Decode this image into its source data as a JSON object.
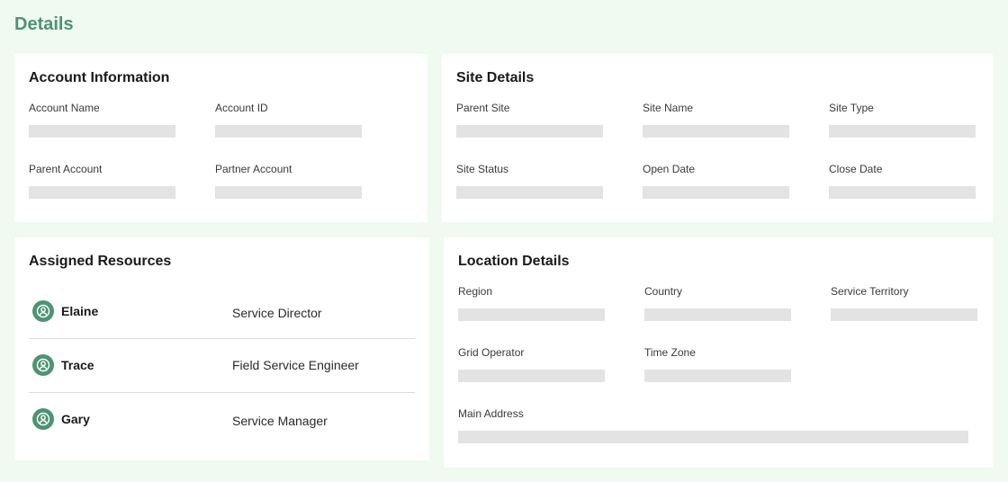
{
  "page": {
    "title": "Details"
  },
  "account_information": {
    "title": "Account Information",
    "fields": [
      "Account Name",
      "Account ID",
      "Parent Account",
      "Partner Account"
    ]
  },
  "site_details": {
    "title": "Site Details",
    "fields": [
      "Parent Site",
      "Site Name",
      "Site Type",
      "Site Status",
      "Open Date",
      "Close Date"
    ]
  },
  "assigned_resources": {
    "title": "Assigned Resources",
    "items": [
      {
        "name": "Elaine",
        "role": "Service Director",
        "icon": "user-icon"
      },
      {
        "name": "Trace",
        "role": "Field Service Engineer",
        "icon": "user-icon"
      },
      {
        "name": "Gary",
        "role": "Service Manager",
        "icon": "user-icon"
      }
    ]
  },
  "location_details": {
    "title": "Location Details",
    "fields": [
      "Region",
      "Country",
      "Service Territory",
      "Grid Operator",
      "Time Zone",
      "Main Address"
    ]
  },
  "colors": {
    "accent": "#4e9373",
    "page_background": "#f0faf0",
    "placeholder": "#e3e3e3"
  }
}
